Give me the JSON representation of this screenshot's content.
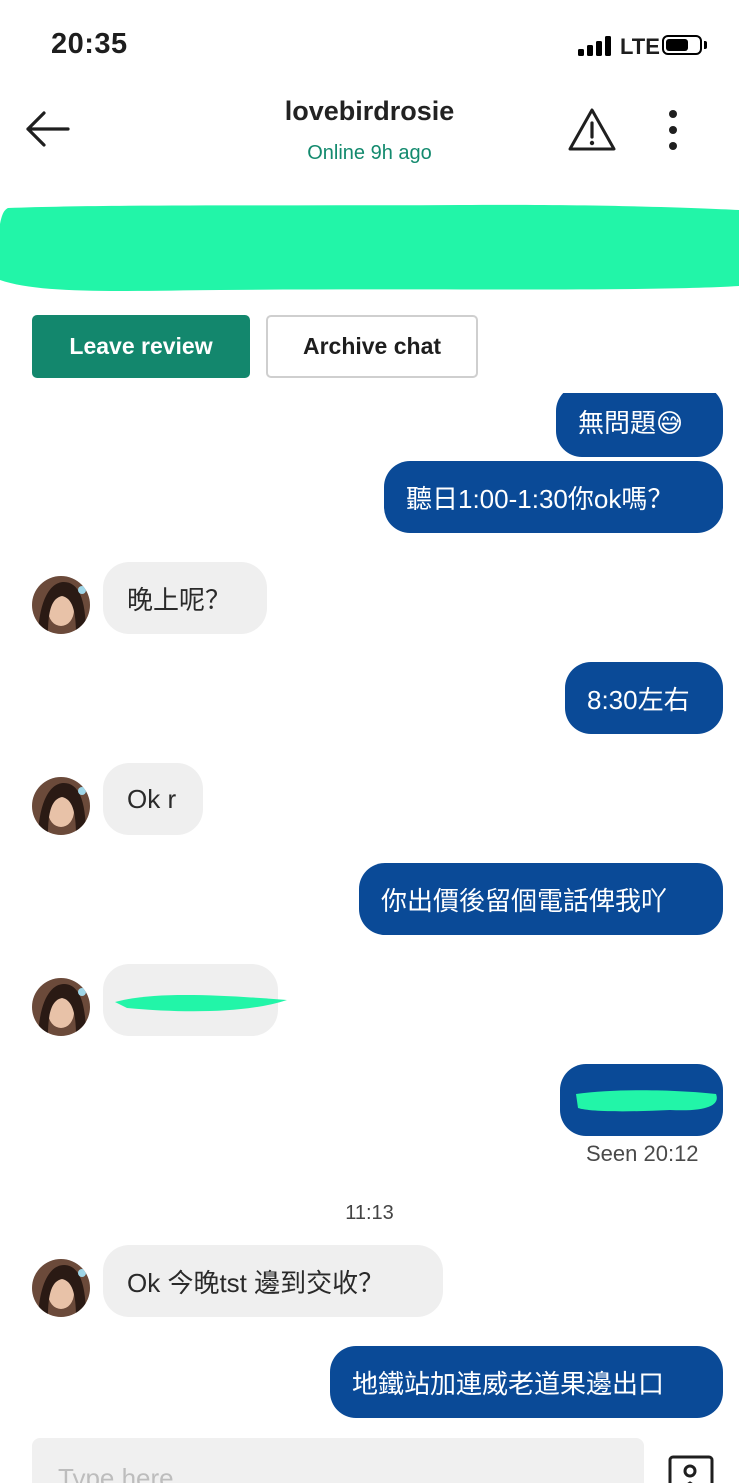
{
  "status_bar": {
    "time": "20:35",
    "network": "LTE",
    "battery_level": 0.7
  },
  "header": {
    "username": "lovebirdrosie",
    "status": "Online 9h ago"
  },
  "colors": {
    "accent": "#13876d",
    "outgoing_bubble": "#0a4a97",
    "incoming_bubble": "#efefef",
    "redaction": "#22f5a8"
  },
  "actions": {
    "leave_review": "Leave review",
    "archive_chat": "Archive chat"
  },
  "messages": [
    {
      "direction": "out",
      "text": "無問題😅"
    },
    {
      "direction": "out",
      "text": "聽日1:00-1:30你ok嗎？"
    },
    {
      "direction": "in",
      "text": "晚上呢？"
    },
    {
      "direction": "out",
      "text": "8:30左右"
    },
    {
      "direction": "in",
      "text": "Ok r"
    },
    {
      "direction": "out",
      "text": "你出價後留個電話俾我吖"
    },
    {
      "direction": "in",
      "text": "",
      "redacted": true
    },
    {
      "direction": "out",
      "text": "",
      "redacted": true,
      "seen": "Seen 20:12"
    },
    {
      "divider": "11:13"
    },
    {
      "direction": "in",
      "text": "Ok 今晚tst 邊到交收？"
    },
    {
      "direction": "out",
      "text": "地鐵站加連威老道果邊出口"
    }
  ],
  "composer": {
    "placeholder": "Type here"
  },
  "icons": {
    "back": "arrow-left-icon",
    "report": "warning-triangle-icon",
    "more": "more-vertical-icon",
    "image": "image-upload-icon"
  }
}
